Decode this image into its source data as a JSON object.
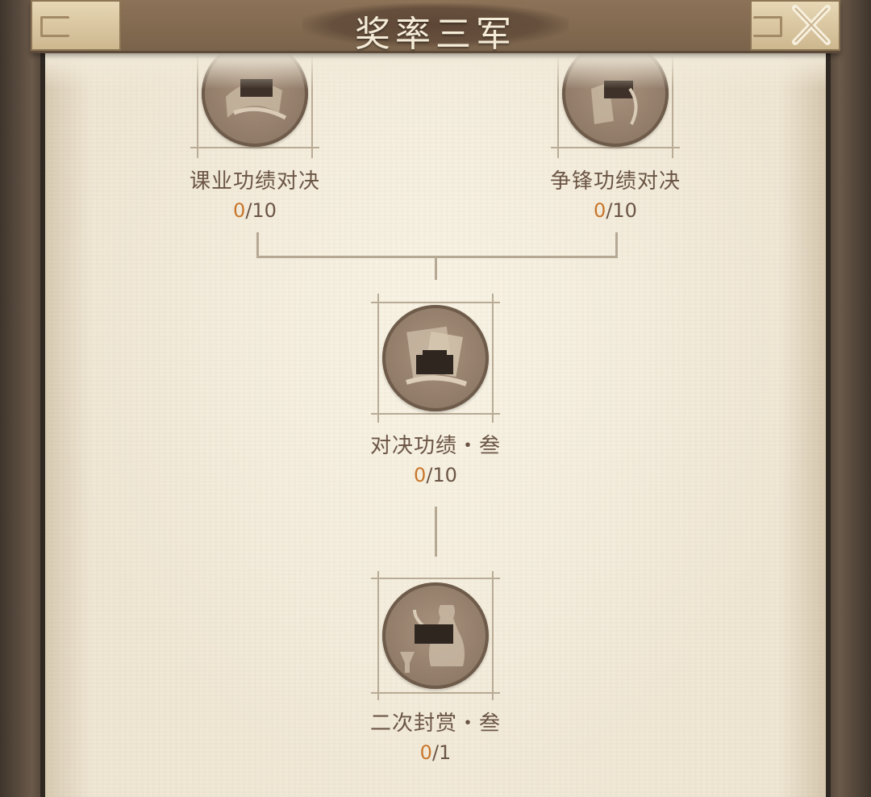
{
  "header": {
    "title": "奖率三军",
    "close_icon": "close-icon"
  },
  "nodes": [
    {
      "label": "课业功绩对决",
      "current": "0",
      "total": "/10",
      "icon": "scroll-icon"
    },
    {
      "label": "争锋功绩对决",
      "current": "0",
      "total": "/10",
      "icon": "scroll-icon"
    },
    {
      "label": "对决功绩・叁",
      "current": "0",
      "total": "/10",
      "icon": "documents-icon"
    },
    {
      "label": "二次封赏・叁",
      "current": "0",
      "total": "/1",
      "icon": "wine-jug-icon"
    }
  ],
  "colors": {
    "accent_progress": "#c8762b",
    "text": "#6b5545",
    "paper": "#f2ead9",
    "frame": "#4a3f36"
  }
}
